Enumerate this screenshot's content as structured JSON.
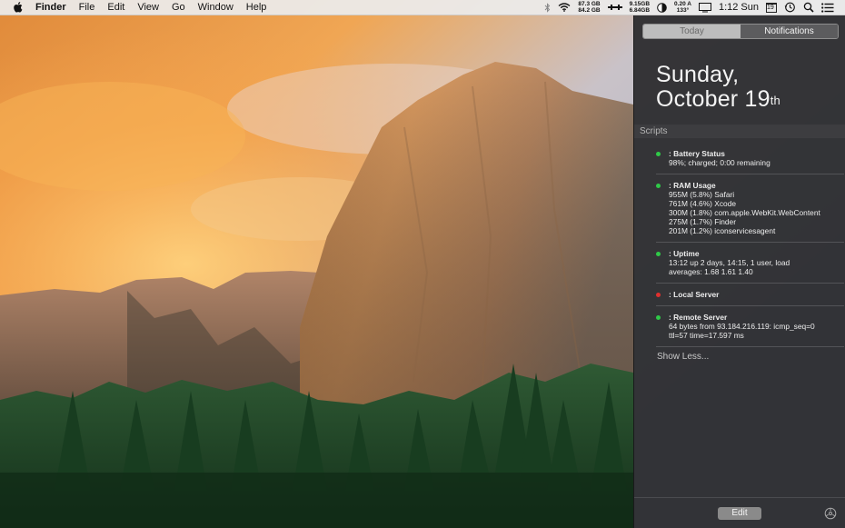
{
  "menubar": {
    "app": "Finder",
    "items": [
      "File",
      "Edit",
      "View",
      "Go",
      "Window",
      "Help"
    ],
    "disk": {
      "line1": "87.3 GB",
      "line2": "84.2 GB"
    },
    "network": {
      "line1": "9.15GB",
      "line2": "6.84GB"
    },
    "sensor": {
      "line1": "0.20 A",
      "line2": "133°"
    },
    "clock": "1:12 Sun",
    "calendar_day": "19",
    "icons": [
      "apple-icon",
      "bluetooth-icon",
      "wifi-icon",
      "network-activity-icon",
      "moon-phase-icon",
      "display-icon",
      "time-machine-icon",
      "spotlight-icon",
      "notification-center-icon"
    ]
  },
  "nc": {
    "tabs": {
      "today": "Today",
      "notifications": "Notifications"
    },
    "date": {
      "weekday": "Sunday,",
      "month_day": "October 19",
      "suffix": "th"
    },
    "section": "Scripts",
    "scripts": [
      {
        "title": ": Battery Status",
        "status_color": "#2fc948",
        "lines": [
          "98%; charged; 0:00 remaining"
        ]
      },
      {
        "title": ": RAM Usage",
        "status_color": "#2fc948",
        "lines": [
          "955M (5.8%) Safari",
          "761M (4.6%) Xcode",
          "300M (1.8%) com.apple.WebKit.WebContent",
          "275M (1.7%) Finder",
          "201M (1.2%) iconservicesagent"
        ]
      },
      {
        "title": ": Uptime",
        "status_color": "#2fc948",
        "lines": [
          "13:12  up 2 days, 14:15, 1 user, load",
          "averages: 1.68 1.61 1.40"
        ]
      },
      {
        "title": ": Local Server",
        "status_color": "#e0302e",
        "lines": []
      },
      {
        "title": ": Remote Server",
        "status_color": "#2fc948",
        "lines": [
          "64 bytes from 93.184.216.119: icmp_seq=0",
          "ttl=57 time=17.597 ms"
        ]
      }
    ],
    "show_less": "Show Less...",
    "edit": "Edit"
  }
}
